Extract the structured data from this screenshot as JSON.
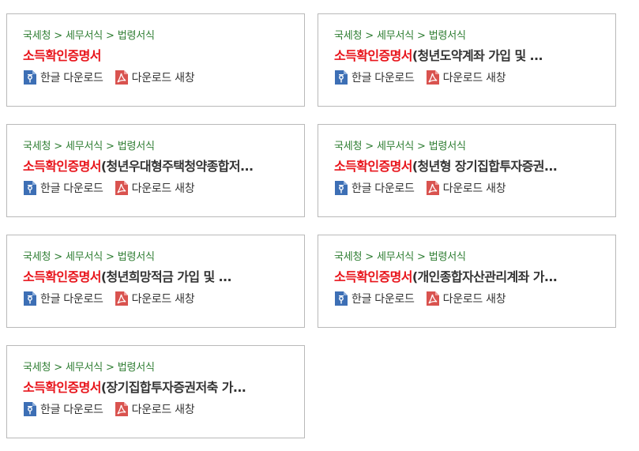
{
  "cards": [
    {
      "breadcrumb": [
        "국세청",
        "세무서식",
        "법령서식"
      ],
      "title_highlight": "소득확인증명서",
      "title_rest": "",
      "actions": [
        {
          "label": "한글 다운로드",
          "icon": "hwp-file-icon"
        },
        {
          "label": "다운로드 새창",
          "icon": "pdf-file-icon"
        }
      ]
    },
    {
      "breadcrumb": [
        "국세청",
        "세무서식",
        "법령서식"
      ],
      "title_highlight": "소득확인증명서",
      "title_rest": "(청년도약계좌 가입 및 ...",
      "actions": [
        {
          "label": "한글 다운로드",
          "icon": "hwp-file-icon"
        },
        {
          "label": "다운로드 새창",
          "icon": "pdf-file-icon"
        }
      ]
    },
    {
      "breadcrumb": [
        "국세청",
        "세무서식",
        "법령서식"
      ],
      "title_highlight": "소득확인증명서",
      "title_rest": "(청년우대형주택청약종합저...",
      "actions": [
        {
          "label": "한글 다운로드",
          "icon": "hwp-file-icon"
        },
        {
          "label": "다운로드 새창",
          "icon": "pdf-file-icon"
        }
      ]
    },
    {
      "breadcrumb": [
        "국세청",
        "세무서식",
        "법령서식"
      ],
      "title_highlight": "소득확인증명서",
      "title_rest": "(청년형 장기집합투자증권...",
      "actions": [
        {
          "label": "한글 다운로드",
          "icon": "hwp-file-icon"
        },
        {
          "label": "다운로드 새창",
          "icon": "pdf-file-icon"
        }
      ]
    },
    {
      "breadcrumb": [
        "국세청",
        "세무서식",
        "법령서식"
      ],
      "title_highlight": "소득확인증명서",
      "title_rest": "(청년희망적금 가입 및 ...",
      "actions": [
        {
          "label": "한글 다운로드",
          "icon": "hwp-file-icon"
        },
        {
          "label": "다운로드 새창",
          "icon": "pdf-file-icon"
        }
      ]
    },
    {
      "breadcrumb": [
        "국세청",
        "세무서식",
        "법령서식"
      ],
      "title_highlight": "소득확인증명서",
      "title_rest": "(개인종합자산관리계좌 가...",
      "actions": [
        {
          "label": "한글 다운로드",
          "icon": "hwp-file-icon"
        },
        {
          "label": "다운로드 새창",
          "icon": "pdf-file-icon"
        }
      ]
    },
    {
      "breadcrumb": [
        "국세청",
        "세무서식",
        "법령서식"
      ],
      "title_highlight": "소득확인증명서",
      "title_rest": "(장기집합투자증권저축 가...",
      "actions": [
        {
          "label": "한글 다운로드",
          "icon": "hwp-file-icon"
        },
        {
          "label": "다운로드 새창",
          "icon": "pdf-file-icon"
        }
      ]
    }
  ],
  "colors": {
    "breadcrumb": "#2e7d32",
    "title_highlight": "#e8141b",
    "hwp_icon": "#3d6fb5",
    "pdf_icon": "#d9534f"
  }
}
